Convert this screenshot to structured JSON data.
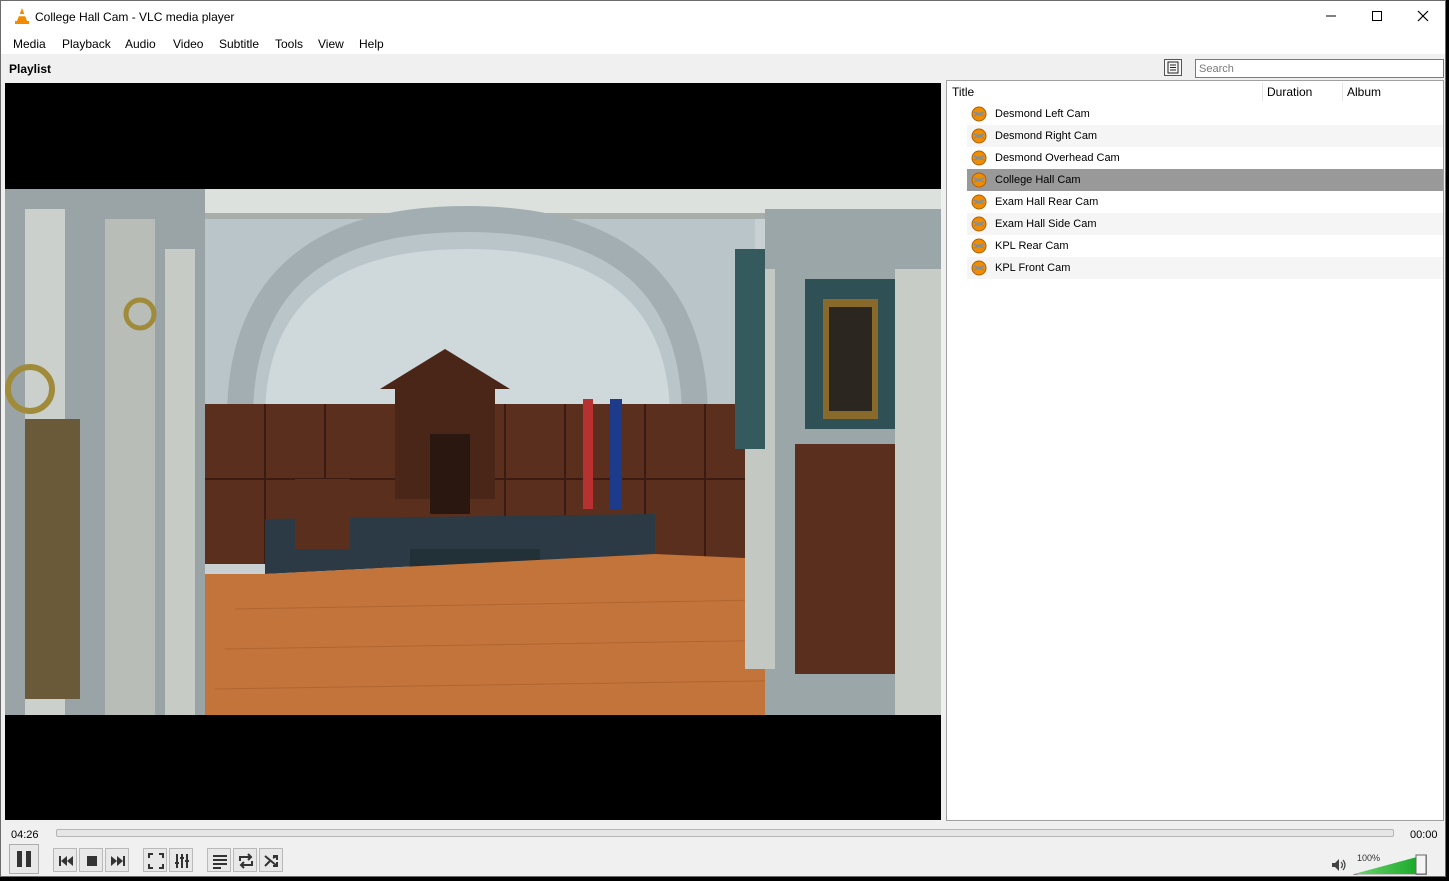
{
  "window": {
    "title": "College Hall Cam - VLC media player"
  },
  "menu": [
    "Media",
    "Playback",
    "Audio",
    "Video",
    "Subtitle",
    "Tools",
    "View",
    "Help"
  ],
  "playlist_bar": {
    "label": "Playlist",
    "search_placeholder": "Search"
  },
  "playlist": {
    "columns": [
      "Title",
      "Duration",
      "Album"
    ],
    "items": [
      {
        "title": "Desmond Left Cam",
        "selected": false
      },
      {
        "title": "Desmond Right Cam",
        "selected": false
      },
      {
        "title": "Desmond Overhead Cam",
        "selected": false
      },
      {
        "title": "College Hall Cam",
        "selected": true
      },
      {
        "title": "Exam Hall Rear Cam",
        "selected": false
      },
      {
        "title": "Exam Hall Side Cam",
        "selected": false
      },
      {
        "title": "KPL Rear Cam",
        "selected": false
      },
      {
        "title": "KPL Front Cam",
        "selected": false
      }
    ]
  },
  "controls": {
    "elapsed": "04:26",
    "remaining": "00:00",
    "volume_label": "100%",
    "volume_level": 1.0,
    "buttons": [
      "pause-icon",
      "previous-icon",
      "stop-icon",
      "next-icon",
      "fullscreen-icon",
      "extended-settings-icon",
      "playlist-icon",
      "loop-icon",
      "shuffle-icon"
    ]
  },
  "colors": {
    "vlc_orange": "#f08c00",
    "selected_row": "#999999",
    "volume_green": "#2ecc40"
  }
}
